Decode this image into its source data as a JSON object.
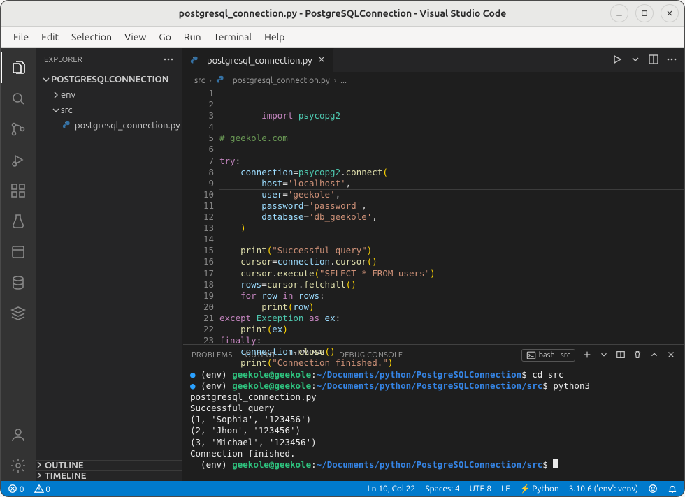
{
  "titlebar": {
    "title": "postgresql_connection.py - PostgreSQLConnection - Visual Studio Code"
  },
  "menubar": [
    "File",
    "Edit",
    "Selection",
    "View",
    "Go",
    "Run",
    "Terminal",
    "Help"
  ],
  "explorer": {
    "header": "EXPLORER",
    "root": "POSTGRESQLCONNECTION",
    "items": [
      {
        "type": "folder",
        "name": "env",
        "expanded": false,
        "depth": 1
      },
      {
        "type": "folder",
        "name": "src",
        "expanded": true,
        "depth": 1
      },
      {
        "type": "file",
        "name": "postgresql_connection.py",
        "depth": 2
      }
    ],
    "outline": "OUTLINE",
    "timeline": "TIMELINE"
  },
  "tabs": {
    "active": {
      "name": "postgresql_connection.py"
    }
  },
  "breadcrumbs": {
    "parts": [
      "src",
      "postgresql_connection.py",
      "..."
    ]
  },
  "code": {
    "total_lines": 23,
    "highlighted_line": 10
  },
  "panel": {
    "tabs": {
      "problems": "PROBLEMS",
      "output": "OUTPUT",
      "terminal": "TERMINAL",
      "debug": "DEBUG CONSOLE"
    },
    "shell_label": "bash - src",
    "prompt_user": "geekole@geekole",
    "prompt_path1": "~/Documents/python/PostgreSQLConnection",
    "prompt_path2": "~/Documents/python/PostgreSQLConnection/src",
    "env_prefix": "(env)",
    "cmd1": "cd src",
    "cmd2": "python3 postgresql_connection.py",
    "output_lines": [
      "Successful query",
      "(1, 'Sophia', '123456')",
      "(2, 'Jhon', '123456')",
      "(3, 'Michael', '123456')",
      "Connection finished."
    ]
  },
  "statusbar": {
    "errors": "0",
    "warnings": "0",
    "lncol": "Ln 10, Col 22",
    "spaces": "Spaces: 4",
    "encoding": "UTF-8",
    "eol": "LF",
    "lang": "Python",
    "interp": "3.10.6 ('env': venv)"
  }
}
